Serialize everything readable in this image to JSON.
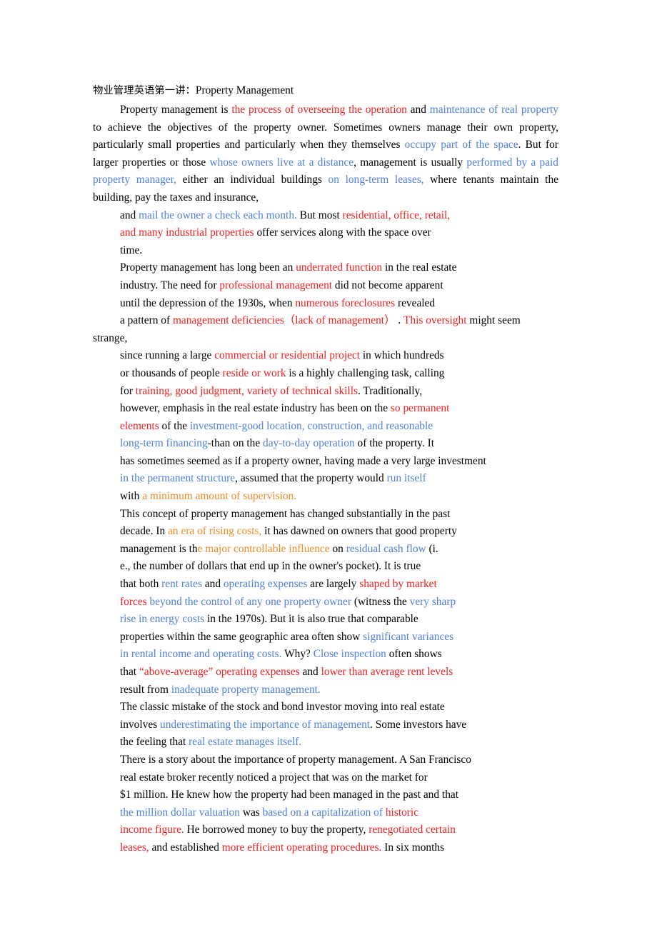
{
  "document": {
    "title_cjk": "物业管理英语第一讲：",
    "title_en": "Property Management",
    "colors": {
      "text": "#000000",
      "red": "#f32020",
      "blue": "#5080dd",
      "orange": "#f28b28",
      "background": "#ffffff"
    },
    "paragraph1": {
      "s1": "Property management is ",
      "s2_red": "the process of overseeing the operation",
      "s3": " and ",
      "s4_blue": "maintenance of real property",
      "s5": " to achieve the objectives of the property owner. Sometimes owners manage their own property, particularly small properties and particularly when they themselves ",
      "s6_blue": "occupy part of the space",
      "s7": ". But for larger properties or those ",
      "s8_blue": "whose owners live at a distance",
      "s9": ", management is usually ",
      "s10_blue": "performed by a paid property manager,",
      "s11": " either an individual buildings ",
      "s12_blue": "on long-term leases,",
      "s13": " where tenants maintain the building, pay the taxes and insurance,"
    },
    "block2": {
      "l1_a": "and ",
      "l1_b_blue": "mail the owner a check each month.",
      "l1_c": " But most ",
      "l1_d_red": "residential, office, retail,",
      "l2_a_red": "and many industrial properties",
      "l2_b": " offer services along with the space over",
      "l3": "time.",
      "l4_a": "Property management has long been an ",
      "l4_b_red": "underrated function",
      "l4_c": " in the real estate",
      "l5_a": "industry. The need for ",
      "l5_b_red": "professional management",
      "l5_c": " did not become apparent",
      "l6_a": "until the depression of the 1930s, when ",
      "l6_b_red": "numerous foreclosures",
      "l6_c": " revealed",
      "l7_a": "a pattern of ",
      "l7_b_red": "management deficiencies（lack of management）",
      "l7_c": " . ",
      "l7_d_red": "This oversight",
      "l7_e": " might seem",
      "l8": "strange,"
    },
    "block3": {
      "l1_a": "since running a large ",
      "l1_b_red": "commercial or residential project",
      "l1_c": " in which hundreds",
      "l2_a": "or thousands of people ",
      "l2_b_red": "reside or work",
      "l2_c": " is a highly challenging task, calling",
      "l3_a": "for ",
      "l3_b_red": "training, good judgment, variety of technical skills",
      "l3_c": ". Traditionally,",
      "l4_a": "however, emphasis in the real estate industry has been on the ",
      "l4_b_red": "so permanent",
      "l5_a_red": "elements",
      "l5_b": " of the ",
      "l5_c_blue": "investment-good location, construction, and reasonable",
      "l6_a_blue": "long-term financing",
      "l6_b": "-than on the ",
      "l6_c_blue": "day-to-day operation",
      "l6_d": " of the property. It",
      "l7": "has sometimes seemed as if a property owner, having made a very large investment",
      "l8_a_blue": "in the permanent structure",
      "l8_b": ", assumed that the property would ",
      "l8_c_blue": "run itself",
      "l9_a": "with ",
      "l9_b_orange": "a minimum amount of supervision."
    },
    "block4": {
      "l1": "This concept of property management has changed substantially in the past",
      "l2_a": "decade. In ",
      "l2_b_orange": "an era of rising costs,",
      "l2_c": " it has dawned on owners that good property",
      "l3_a": "management is th",
      "l3_b_orange": "e major controllable influence",
      "l3_c": " on ",
      "l3_d_blue": "residual cash flow",
      "l3_e": " (i.",
      "l4": "e., the number of dollars that end up in the owner's pocket). It is true",
      "l5_a": "that both ",
      "l5_b_blue": "rent rates",
      "l5_c": " and ",
      "l5_d_blue": "operating expenses",
      "l5_e": " are largely ",
      "l5_f_red": "shaped by market",
      "l6_a_red": "forces",
      "l6_b_blue": " beyond the control of any one property owner",
      "l6_c": " (witness the ",
      "l6_d_blue": "very sharp",
      "l7_a_blue": "rise in energy costs",
      "l7_b": " in the 1970s). But it is also true that comparable",
      "l8_a": "properties within the same geographic area often show ",
      "l8_b_blue": "significant variances",
      "l9_a_blue": "in rental income and operating costs.",
      "l9_b": " Why? ",
      "l9_c_blue": "Close inspection",
      "l9_d": " often shows",
      "l10_a": "that ",
      "l10_b_red": "“above-average” operating expenses",
      "l10_c": " and ",
      "l10_d_red": "lower than average rent levels",
      "l11_a": "result from ",
      "l11_b_blue": "inadequate property management."
    },
    "block5": {
      "l1": "The classic mistake of the stock and bond investor moving into real estate",
      "l2_a": "involves ",
      "l2_b_blue": "underestimating the importance of management",
      "l2_c": ". Some investors have",
      "l3_a": "the feeling that ",
      "l3_b_blue": "real estate manages itself."
    },
    "block6": {
      "l1": "There is a story about the importance of property management. A San Francisco",
      "l2": "real estate broker recently noticed a project that was on the market for",
      "l3": "$1 million. He knew how the property had been managed in the past and that",
      "l4_a_blue": "the million dollar valuation",
      "l4_b": " was ",
      "l4_c_blue": "based on a capitalization of ",
      "l4_d_red": "historic",
      "l5_a_red": "income figure.",
      "l5_b": " He borrowed money to buy the property, ",
      "l5_c_red": "renegotiated certain",
      "l6_a_red": "leases,",
      "l6_b": " and established ",
      "l6_c_red": "more efficient operating procedures.",
      "l6_d": " In six months"
    }
  }
}
